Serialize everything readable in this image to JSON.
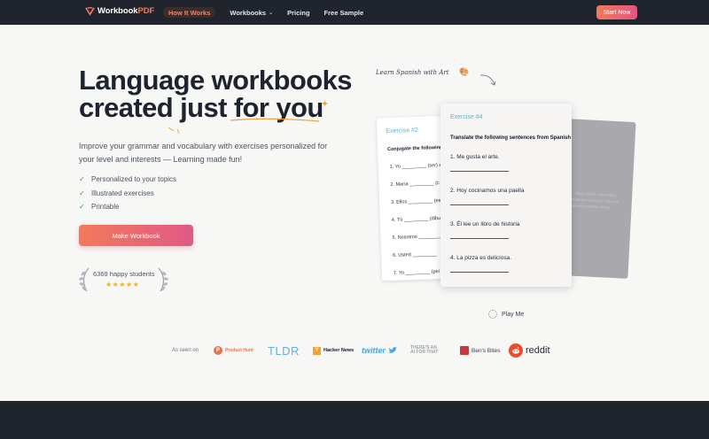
{
  "brand": {
    "name": "Workbook",
    "suffix": "PDF",
    "accent": "#f27b5b"
  },
  "nav": {
    "items": [
      {
        "label": "How It Works",
        "active": true
      },
      {
        "label": "Workbooks",
        "has_dropdown": true
      },
      {
        "label": "Pricing"
      },
      {
        "label": "Free Sample"
      }
    ],
    "cta": "Start Now"
  },
  "hero": {
    "title_line1": "Language workbooks",
    "title_line2": "created just for you",
    "subtitle": "Improve your grammar and vocabulary with exercises personalized for your level and interests — Learning made fun!",
    "features": [
      "Personalized to your topics",
      "Illustrated exercises",
      "Printable"
    ],
    "cta": "Make Workbook",
    "social_proof": "6369 happy students",
    "stars": "★★★★★"
  },
  "visual": {
    "caption": "Learn Spanish with Art",
    "left_card": {
      "exercise": "Exercise #2",
      "title": "Conjugate the following",
      "rows": [
        "1.   Yo _________ (ser) a",
        "2.   María _________ (c",
        "3.   Ellos _________ (es",
        "4.   Tú _________ (dibu",
        "5.   Nosotros _________",
        "6.   Usted _________",
        "7.   Yo _________ (pei"
      ]
    },
    "main_card": {
      "exercise": "Exercise #4",
      "title": "Translate the following sentences from Spanish",
      "questions": [
        "1.   Me gusta el arte.",
        "2.   Hoy cocinamos una paella",
        "3.   Él lee un libro de historia",
        "4.   La pizza es deliciosa."
      ]
    },
    "back_card_text": "...dibujo retrato sobre reflejo fondo con lecturas y creativos Spanish también, yo hoy",
    "play_label": "Play Me"
  },
  "press": {
    "label": "As seen on",
    "product_hunt": "Product Hunt",
    "tldr": "TLDR",
    "hacker_news": "Hacker News",
    "twitter": "twitter",
    "aift_line1": "THERE'S AN",
    "aift_line2": "AI FOR THAT",
    "bens_bites": "Ben's Bites",
    "reddit": "reddit"
  }
}
